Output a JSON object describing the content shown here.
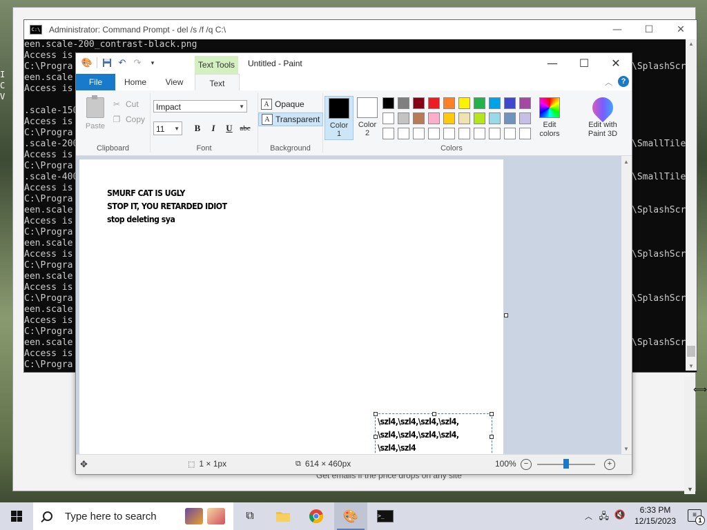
{
  "cmd": {
    "title": "Administrator: Command Prompt - del  /s /f /q C:\\",
    "icon_label": "C:\\",
    "lines": [
      "een.scale-200_contrast-black.png",
      "Access is",
      "C:\\Progra",
      "een.scale",
      "Access is",
      "",
      ".scale-150",
      "Access is",
      "C:\\Progra",
      ".scale-200",
      "Access is",
      "C:\\Progra",
      ".scale-400",
      "Access is",
      "C:\\Progra",
      "een.scale",
      "Access is",
      "C:\\Progra",
      "een.scale",
      "Access is",
      "C:\\Progra",
      "een.scale",
      "Access is",
      "C:\\Progra",
      "een.scale",
      "Access is",
      "C:\\Progra",
      "een.scale",
      "Access is",
      "C:\\Progra",
      "een.scale",
      "Access is"
    ],
    "right_lines": [
      "",
      "",
      "\\SplashScr",
      "",
      "",
      "",
      "",
      "",
      "",
      "\\SmallTile",
      "",
      "",
      "\\SmallTile",
      "",
      "",
      "\\SplashScr",
      "",
      "",
      "",
      "\\SplashScr",
      "",
      "",
      "",
      "\\SplashScr",
      "",
      "",
      "",
      "\\SplashScr"
    ]
  },
  "left_stub": [
    "I",
    "C",
    "V"
  ],
  "browser": {
    "bottom_text": "Get emails if the price drops on any site"
  },
  "paint": {
    "title": "Untitled - Paint",
    "context_tab": "Text Tools",
    "tabs": [
      "File",
      "Home",
      "View",
      "Text"
    ],
    "clipboard": {
      "paste": "Paste",
      "cut": "Cut",
      "copy": "Copy",
      "label": "Clipboard"
    },
    "font": {
      "family": "Impact",
      "size": "11",
      "bold": "B",
      "italic": "I",
      "underline": "U",
      "strike": "abc",
      "label": "Font"
    },
    "background": {
      "opaque": "Opaque",
      "transparent": "Transparent",
      "label": "Background"
    },
    "colors": {
      "color1_line1": "Color",
      "color1_line2": "1",
      "color2_line1": "Color",
      "color2_line2": "2",
      "color1": "#000000",
      "color2": "#ffffff",
      "edit_line1": "Edit",
      "edit_line2": "colors",
      "label": "Colors",
      "palette": [
        "#000000",
        "#7f7f7f",
        "#880015",
        "#ed1c24",
        "#ff7f27",
        "#fff200",
        "#22b14c",
        "#00a2e8",
        "#3f48cc",
        "#a349a4",
        "#ffffff",
        "#c3c3c3",
        "#b97a57",
        "#ffaec9",
        "#ffc90e",
        "#efe4b0",
        "#b5e61d",
        "#99d9ea",
        "#7092be",
        "#c8bfe7",
        "#ffffff",
        "#ffffff",
        "#ffffff",
        "#ffffff",
        "#ffffff",
        "#ffffff",
        "#ffffff",
        "#ffffff",
        "#ffffff",
        "#ffffff"
      ]
    },
    "paint3d": {
      "line1": "Edit with",
      "line2": "Paint 3D"
    },
    "canvas_text": {
      "line1": "SMURF CAT IS UGLY",
      "line2": "STOP IT, YOU RETARDED IDIOT",
      "line3": "stop deleting sya"
    },
    "textbox_lines": [
      "\\szl4,\\szl4,\\szl4,\\szl4,",
      "\\szl4,\\szl4,\\szl4,\\szl4,",
      "\\szl4,\\szl4"
    ],
    "status": {
      "cursor_pos": "",
      "selection": "1 × 1px",
      "image_size": "614 × 460px",
      "zoom": "100%",
      "zoom_fraction": 0.5
    }
  },
  "taskbar": {
    "search_placeholder": "Type here to search",
    "time": "6:33 PM",
    "date": "12/15/2023",
    "notifications": "1"
  }
}
